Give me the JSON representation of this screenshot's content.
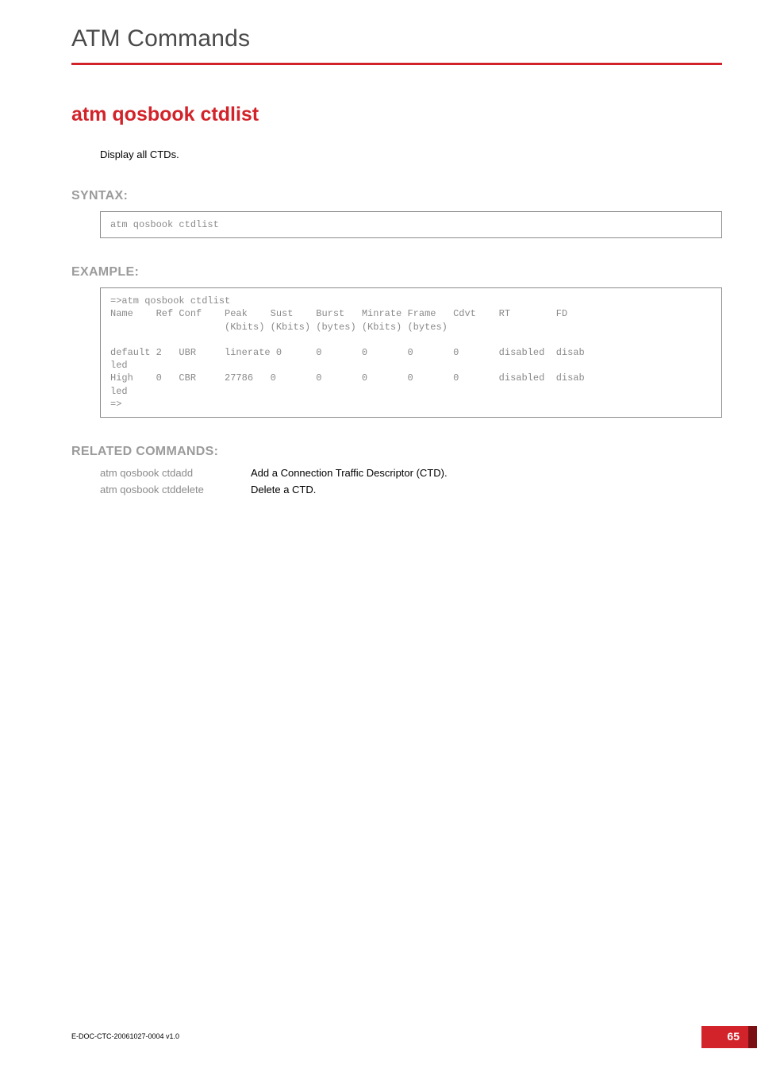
{
  "header": {
    "chapter_title": "ATM Commands"
  },
  "command": {
    "title": "atm qosbook ctdlist",
    "description": "Display all CTDs."
  },
  "syntax": {
    "heading": "SYNTAX:",
    "code": "atm qosbook ctdlist"
  },
  "example": {
    "heading": "EXAMPLE:",
    "code": "=>atm qosbook ctdlist\nName    Ref Conf    Peak    Sust    Burst   Minrate Frame   Cdvt    RT        FD\n                    (Kbits) (Kbits) (bytes) (Kbits) (bytes)\n\ndefault 2   UBR     linerate 0      0       0       0       0       disabled  disab\nled\nHigh    0   CBR     27786   0       0       0       0       0       disabled  disab\nled\n=>"
  },
  "chart_data": {
    "type": "table",
    "title": "atm qosbook ctdlist output",
    "columns": [
      "Name",
      "Ref",
      "Conf",
      "Peak (Kbits)",
      "Sust (Kbits)",
      "Burst (bytes)",
      "Minrate (Kbits)",
      "Frame (bytes)",
      "Cdvt",
      "RT",
      "FD"
    ],
    "rows": [
      [
        "default",
        2,
        "UBR",
        "linerate",
        0,
        0,
        0,
        0,
        0,
        "disabled",
        "disabled"
      ],
      [
        "High",
        0,
        "CBR",
        27786,
        0,
        0,
        0,
        0,
        0,
        "disabled",
        "disabled"
      ]
    ]
  },
  "related": {
    "heading": "RELATED COMMANDS:",
    "rows": [
      {
        "cmd": "atm qosbook ctdadd",
        "desc": "Add a Connection Traffic Descriptor (CTD)."
      },
      {
        "cmd": "atm qosbook ctddelete",
        "desc": "Delete a CTD."
      }
    ]
  },
  "footer": {
    "doc_id": "E-DOC-CTC-20061027-0004 v1.0",
    "page_number": "65"
  }
}
